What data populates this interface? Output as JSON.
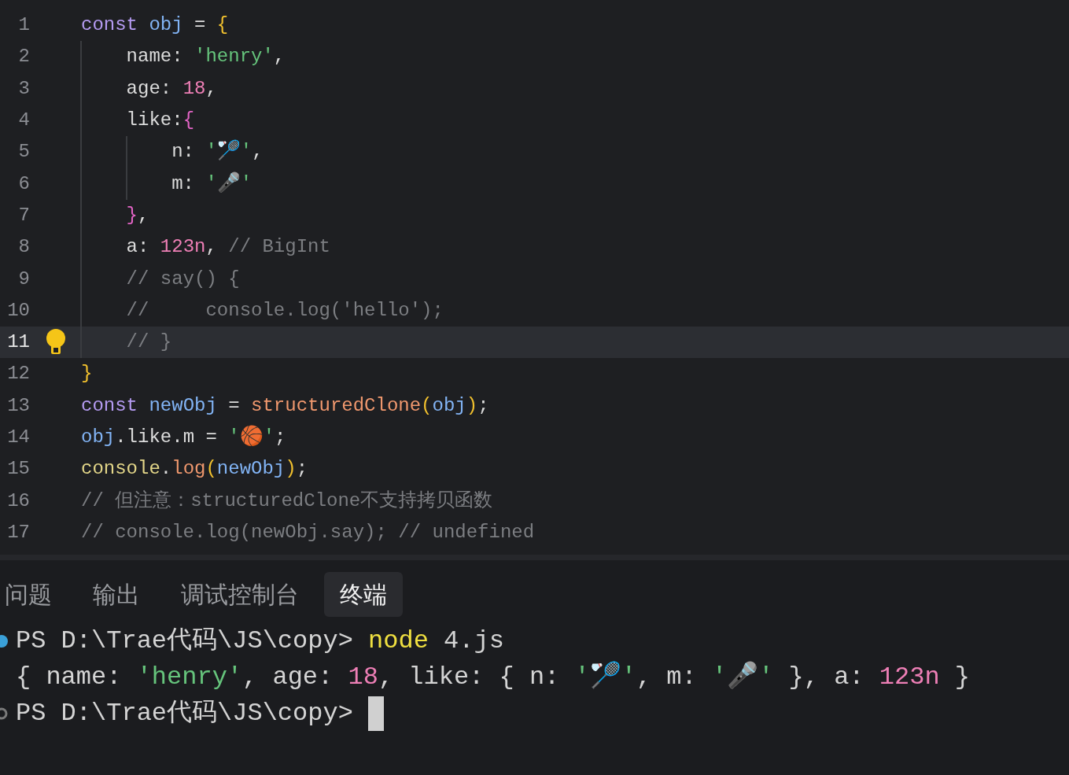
{
  "editor": {
    "lines": [
      {
        "number": "1",
        "selected": false,
        "tokens": [
          {
            "kind": "keyword",
            "text": "const"
          },
          {
            "kind": "variable",
            "text": " obj"
          },
          {
            "kind": "plain",
            "text": " = "
          },
          {
            "kind": "brace",
            "text": "{"
          }
        ]
      },
      {
        "number": "2",
        "selected": false,
        "tokens": [
          {
            "kind": "plain",
            "text": "    name: "
          },
          {
            "kind": "string",
            "text": "'henry'"
          },
          {
            "kind": "plain",
            "text": ","
          }
        ]
      },
      {
        "number": "3",
        "selected": false,
        "tokens": [
          {
            "kind": "plain",
            "text": "    age: "
          },
          {
            "kind": "number",
            "text": "18"
          },
          {
            "kind": "plain",
            "text": ","
          }
        ]
      },
      {
        "number": "4",
        "selected": false,
        "tokens": [
          {
            "kind": "plain",
            "text": "    like:"
          },
          {
            "kind": "brace2",
            "text": "{"
          }
        ]
      },
      {
        "number": "5",
        "selected": false,
        "tokens": [
          {
            "kind": "plain",
            "text": "        n: "
          },
          {
            "kind": "string",
            "text": "'🏸'"
          },
          {
            "kind": "plain",
            "text": ","
          }
        ]
      },
      {
        "number": "6",
        "selected": false,
        "tokens": [
          {
            "kind": "plain",
            "text": "        m: "
          },
          {
            "kind": "string",
            "text": "'🎤'"
          }
        ]
      },
      {
        "number": "7",
        "selected": false,
        "tokens": [
          {
            "kind": "brace2",
            "text": "    }"
          },
          {
            "kind": "plain",
            "text": ","
          }
        ]
      },
      {
        "number": "8",
        "selected": false,
        "tokens": [
          {
            "kind": "plain",
            "text": "    a: "
          },
          {
            "kind": "number",
            "text": "123n"
          },
          {
            "kind": "plain",
            "text": ", "
          },
          {
            "kind": "comment",
            "text": "// BigInt"
          }
        ]
      },
      {
        "number": "9",
        "selected": false,
        "tokens": [
          {
            "kind": "comment",
            "text": "    // say() {"
          }
        ]
      },
      {
        "number": "10",
        "selected": false,
        "tokens": [
          {
            "kind": "comment",
            "text": "    //     console.log('hello');"
          }
        ]
      },
      {
        "number": "11",
        "selected": true,
        "lightbulb": true,
        "tokens": [
          {
            "kind": "comment",
            "text": "    // }"
          }
        ]
      },
      {
        "number": "12",
        "selected": false,
        "tokens": [
          {
            "kind": "brace",
            "text": "}"
          }
        ]
      },
      {
        "number": "13",
        "selected": false,
        "tokens": [
          {
            "kind": "keyword",
            "text": "const"
          },
          {
            "kind": "variable",
            "text": " newObj"
          },
          {
            "kind": "plain",
            "text": " = "
          },
          {
            "kind": "function",
            "text": "structuredClone"
          },
          {
            "kind": "brace",
            "text": "("
          },
          {
            "kind": "variable",
            "text": "obj"
          },
          {
            "kind": "brace",
            "text": ")"
          },
          {
            "kind": "plain",
            "text": ";"
          }
        ]
      },
      {
        "number": "14",
        "selected": false,
        "tokens": [
          {
            "kind": "variable",
            "text": "obj"
          },
          {
            "kind": "plain",
            "text": ".like.m = "
          },
          {
            "kind": "string",
            "text": "'🏀'"
          },
          {
            "kind": "plain",
            "text": ";"
          }
        ]
      },
      {
        "number": "15",
        "selected": false,
        "tokens": [
          {
            "kind": "object",
            "text": "console"
          },
          {
            "kind": "plain",
            "text": "."
          },
          {
            "kind": "function",
            "text": "log"
          },
          {
            "kind": "brace",
            "text": "("
          },
          {
            "kind": "variable",
            "text": "newObj"
          },
          {
            "kind": "brace",
            "text": ")"
          },
          {
            "kind": "plain",
            "text": ";"
          }
        ]
      },
      {
        "number": "16",
        "selected": false,
        "tokens": [
          {
            "kind": "comment",
            "text": "// 但注意：structuredClone不支持拷贝函数"
          }
        ]
      },
      {
        "number": "17",
        "selected": false,
        "tokens": [
          {
            "kind": "comment",
            "text": "// console.log(newObj.say); // undefined"
          }
        ]
      }
    ]
  },
  "panel": {
    "tabs": [
      {
        "label": "问题",
        "selected": false
      },
      {
        "label": "输出",
        "selected": false
      },
      {
        "label": "调试控制台",
        "selected": false
      },
      {
        "label": "终端",
        "selected": true
      }
    ],
    "terminal": [
      {
        "done": true,
        "cursor": false,
        "tokens": [
          {
            "kind": "plain",
            "text": "PS D:\\Trae代码\\JS\\copy> "
          },
          {
            "kind": "command",
            "text": "node"
          },
          {
            "kind": "plain",
            "text": " 4.js"
          }
        ]
      },
      {
        "cursor": false,
        "tokens": [
          {
            "kind": "plain",
            "text": "{ name: "
          },
          {
            "kind": "string",
            "text": "'henry'"
          },
          {
            "kind": "plain",
            "text": ", age: "
          },
          {
            "kind": "number",
            "text": "18"
          },
          {
            "kind": "plain",
            "text": ", like: { n: "
          },
          {
            "kind": "string",
            "text": "'🏸'"
          },
          {
            "kind": "plain",
            "text": ", m: "
          },
          {
            "kind": "string",
            "text": "'🎤'"
          },
          {
            "kind": "plain",
            "text": " }, a: "
          },
          {
            "kind": "number",
            "text": "123n"
          },
          {
            "kind": "plain",
            "text": " }"
          }
        ]
      },
      {
        "done": false,
        "cursor": true,
        "tokens": [
          {
            "kind": "plain",
            "text": "PS D:\\Trae代码\\JS\\copy> "
          }
        ]
      }
    ]
  }
}
